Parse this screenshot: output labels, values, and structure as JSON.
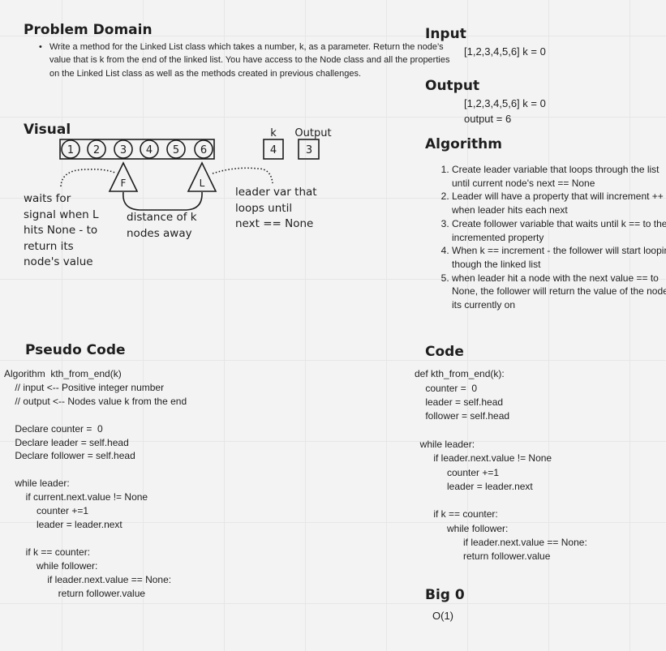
{
  "problem_domain": {
    "heading": "Problem Domain",
    "bullet": "Write a method for the Linked List class which takes a number, k, as a parameter. Return the node’s value that is k from the end of the linked list. You have access to the Node class and all the properties on the Linked List class as well as the methods created in previous challenges."
  },
  "input": {
    "heading": "Input",
    "value": "[1,2,3,4,5,6] k = 0"
  },
  "output": {
    "heading": "Output",
    "value_line1": "[1,2,3,4,5,6] k = 0",
    "value_line2": "output = 6"
  },
  "visual": {
    "heading": "Visual",
    "nodes": [
      "1",
      "2",
      "3",
      "4",
      "5",
      "6"
    ],
    "k_label": "k",
    "k_value": "4",
    "output_label": "Output",
    "output_value": "3",
    "follower_marker": "F",
    "leader_marker": "L",
    "note_follower": "waits for\nsignal when L\nhits None - to\nreturn its\nnode's value",
    "note_distance": "distance of k\nnodes away",
    "note_leader": "leader var that\nloops until\nnext == None"
  },
  "algorithm": {
    "heading": "Algorithm",
    "steps": [
      "Create leader variable that loops through the list until current node's next == None",
      "Leader will have a property that will increment ++ when leader hits each next",
      "Create follower variable that waits until k == to the incremented property",
      "When k == increment - the follower will start looping though the linked list",
      "when leader hit a node with the next value == to None, the follower will return the value of the node its currently on"
    ]
  },
  "pseudo_code": {
    "heading": "Pseudo Code",
    "body": "Algorithm  kth_from_end(k)\n    // input <-- Positive integer number\n    // output <-- Nodes value k from the end\n\n    Declare counter =  0\n    Declare leader = self.head\n    Declare follower = self.head\n\n    while leader:\n        if current.next.value != None\n            counter +=1\n            leader = leader.next\n\n        if k == counter:\n            while follower:\n                if leader.next.value == None:\n                    return follower.value"
  },
  "code": {
    "heading": "Code",
    "line1": "def kth_from_end(k):",
    "block1": "    counter =  0\n    leader = self.head\n    follower = self.head",
    "block2": "  while leader:\n       if leader.next.value != None\n            counter +=1\n            leader = leader.next\n\n       if k == counter:\n            while follower:\n                  if leader.next.value == None:\n                  return follower.value"
  },
  "big_o": {
    "heading": "Big 0",
    "value": "O(1)"
  }
}
